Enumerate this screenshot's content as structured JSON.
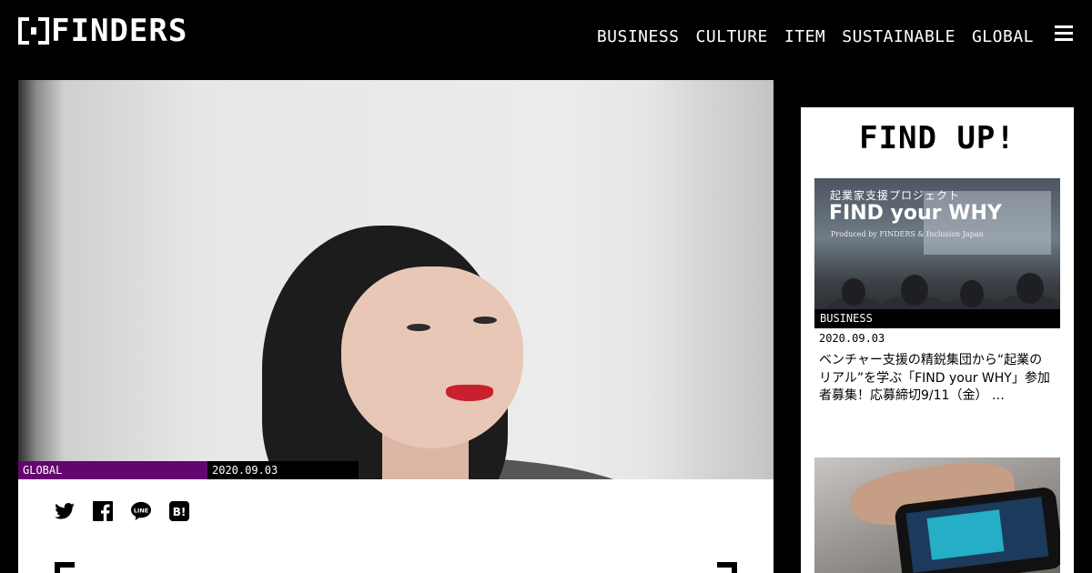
{
  "header": {
    "logo_text": "FINDERS",
    "nav": [
      "BUSINESS",
      "CULTURE",
      "ITEM",
      "SUSTAINABLE",
      "GLOBAL"
    ]
  },
  "hero": {
    "category": "GLOBAL",
    "date": "2020.09.03",
    "category_color": "#64066f"
  },
  "share": [
    "twitter-icon",
    "facebook-icon",
    "line-icon",
    "hatena-bookmark-icon"
  ],
  "sidebar": {
    "heading": "FIND UP!",
    "card1": {
      "thumb_small": "起業家支援プロジェクト",
      "thumb_title": "FIND your WHY",
      "thumb_sub": "Produced by FINDERS & Inclusion Japan",
      "category": "BUSINESS",
      "date": "2020.09.03",
      "title": "ベンチャー支援の精鋭集団から“起業のリアル”を学ぶ「FIND your WHY」参加者募集！応募締切9/11（金） …"
    }
  },
  "colors": {
    "background": "#000000",
    "panel": "#ffffff",
    "accent_global": "#64066f"
  }
}
